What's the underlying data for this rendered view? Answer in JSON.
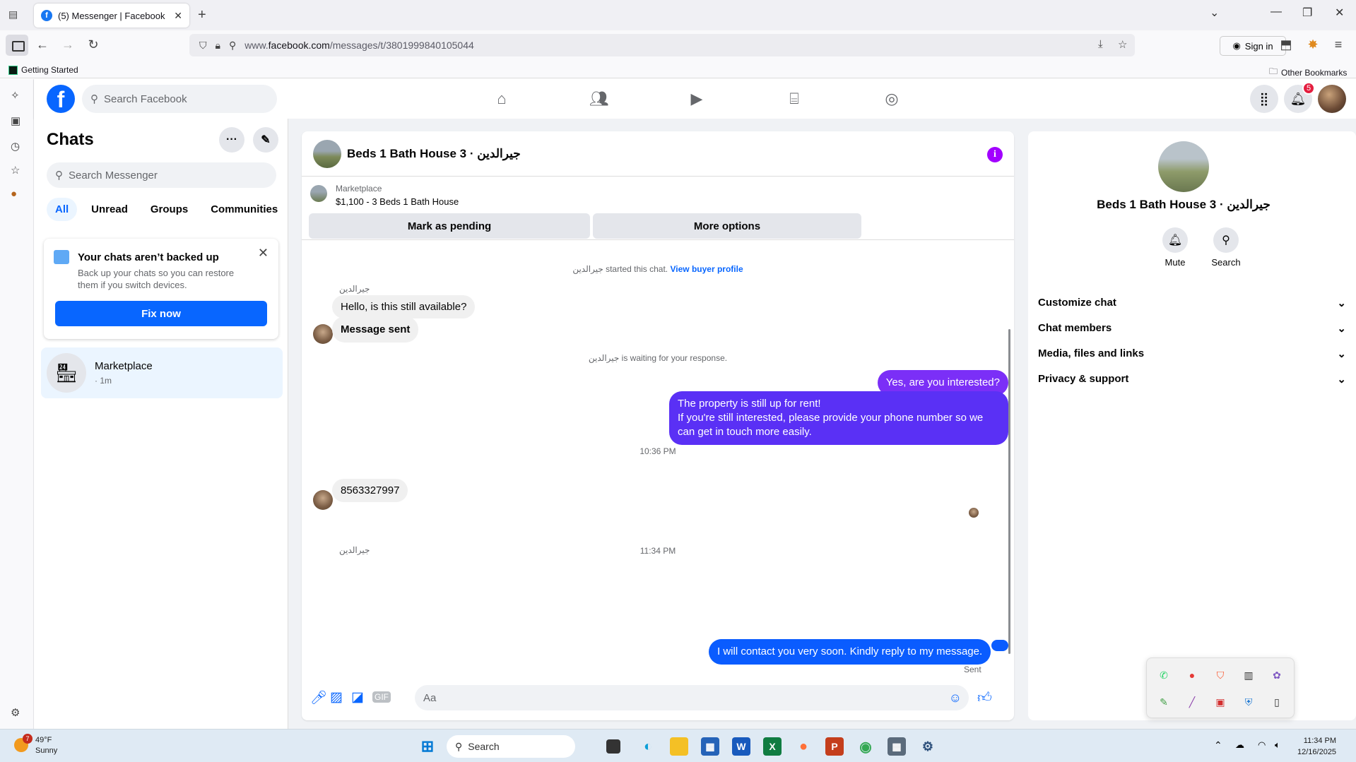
{
  "browser": {
    "tab_title": "(5) Messenger | Facebook",
    "url_prefix": "www.",
    "url_domain": "facebook.com",
    "url_path": "/messages/t/3801999840105044",
    "sign_in": "Sign in",
    "bookmark_getting_started": "Getting Started",
    "bookmark_other": "Other Bookmarks"
  },
  "fb": {
    "search_placeholder": "Search Facebook",
    "notification_count": "5"
  },
  "chats": {
    "title": "Chats",
    "search_placeholder": "Search Messenger",
    "filters": [
      "All",
      "Unread",
      "Groups",
      "Communities"
    ],
    "backup_title": "Your chats aren’t backed up",
    "backup_text": "Back up your chats so you can restore them if you switch devices.",
    "fix_now": "Fix now",
    "conversation_name": "Marketplace",
    "conversation_time": "· 1m"
  },
  "conversation": {
    "title": "Beds 1 Bath House 3 · جيرالدين",
    "marketplace_label": "Marketplace",
    "listing": "$1,100 - 3 Beds 1 Bath House",
    "mark_pending": "Mark as pending",
    "more_options": "More options",
    "started_text": "جيرالدين started this chat.",
    "view_buyer": "View buyer profile",
    "sender_name": "جيرالدين",
    "msg1": "Hello, is this still available?",
    "msg2": "Message sent",
    "waiting_text": "جيرالدين is waiting for your response.",
    "reply1": "Yes, are you interested?",
    "reply2": "The property is still up for rent!\nIf you're still interested, please provide your phone number so we can get in touch more easily.",
    "time1": "10:36 PM",
    "sender_name2": "جيرالدين",
    "msg3": "8563327997",
    "time2": "11:34 PM",
    "reply3": "I will contact you very soon. Kindly reply to my message.",
    "sent_status": "Sent",
    "composer_placeholder": "Aa"
  },
  "info_panel": {
    "name": "Beds 1 Bath House 3 · جيرالدين",
    "mute": "Mute",
    "search": "Search",
    "sections": [
      "Customize chat",
      "Chat members",
      "Media, files and links",
      "Privacy & support"
    ]
  },
  "taskbar": {
    "weather_temp": "49°F",
    "weather_cond": "Sunny",
    "weather_badge": "7",
    "search": "Search",
    "time": "11:34 PM",
    "date": "12/16/2025"
  },
  "colors": {
    "fb_blue": "#0866ff",
    "bubble_purple": "#7b2ff7",
    "bubble_blue": "#0a5cff"
  }
}
